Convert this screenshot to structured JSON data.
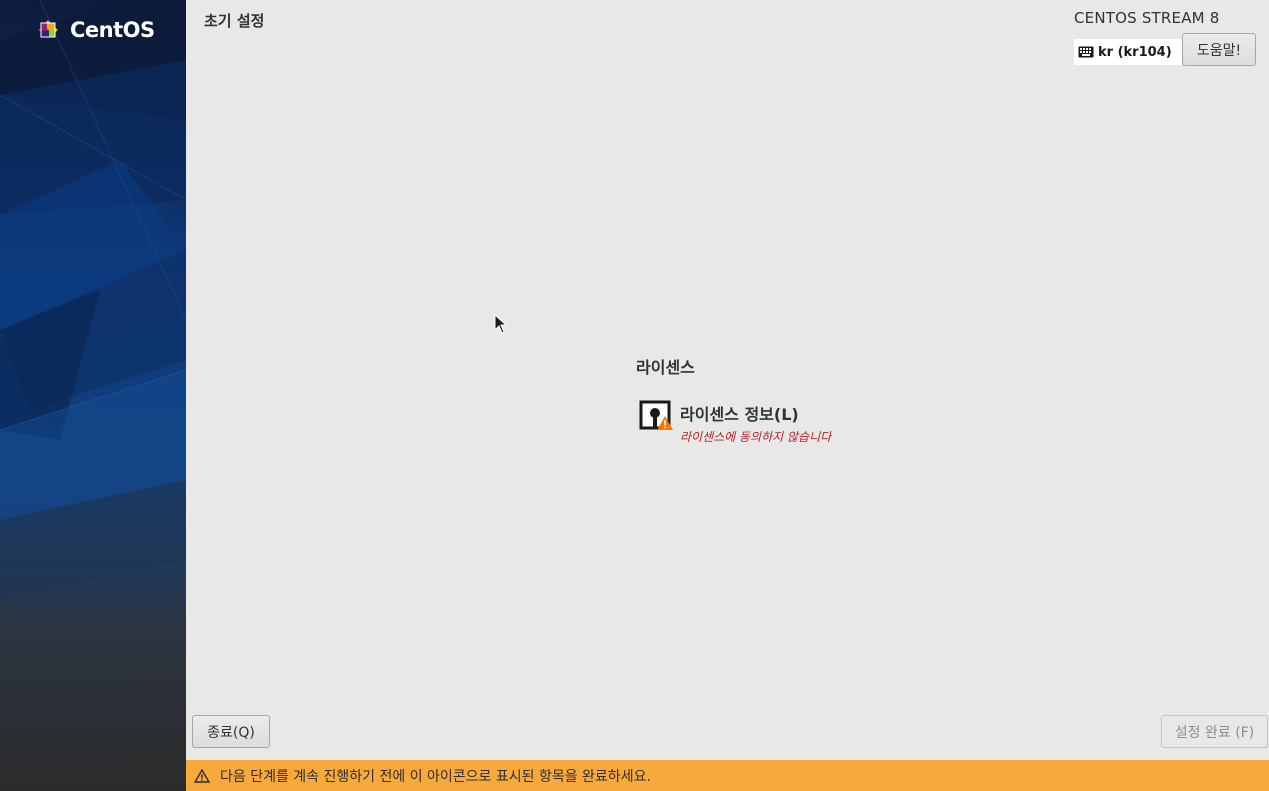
{
  "sidebar": {
    "logo_text": "CentOS"
  },
  "header": {
    "title": "초기 설정",
    "product": "CENTOS STREAM 8",
    "keyboard_layout": "kr (kr104)",
    "help_label": "도움말!"
  },
  "content": {
    "section_title": "라이센스",
    "spoke": {
      "title": "라이센스 정보(L)",
      "status": "라이센스에 동의하지 않습니다"
    }
  },
  "footer": {
    "quit_label": "종료(Q)",
    "finish_label": "설정 완료 (F)",
    "warning_text": "다음 단계를 계속 진행하기 전에 이 아이콘으로 표시된 항목을 완료하세요."
  },
  "colors": {
    "warning_bar": "#f8a93b",
    "status_error": "#c01c28",
    "sidebar_top": "#0f1f3f",
    "sidebar_bottom": "#2b2b2b"
  }
}
